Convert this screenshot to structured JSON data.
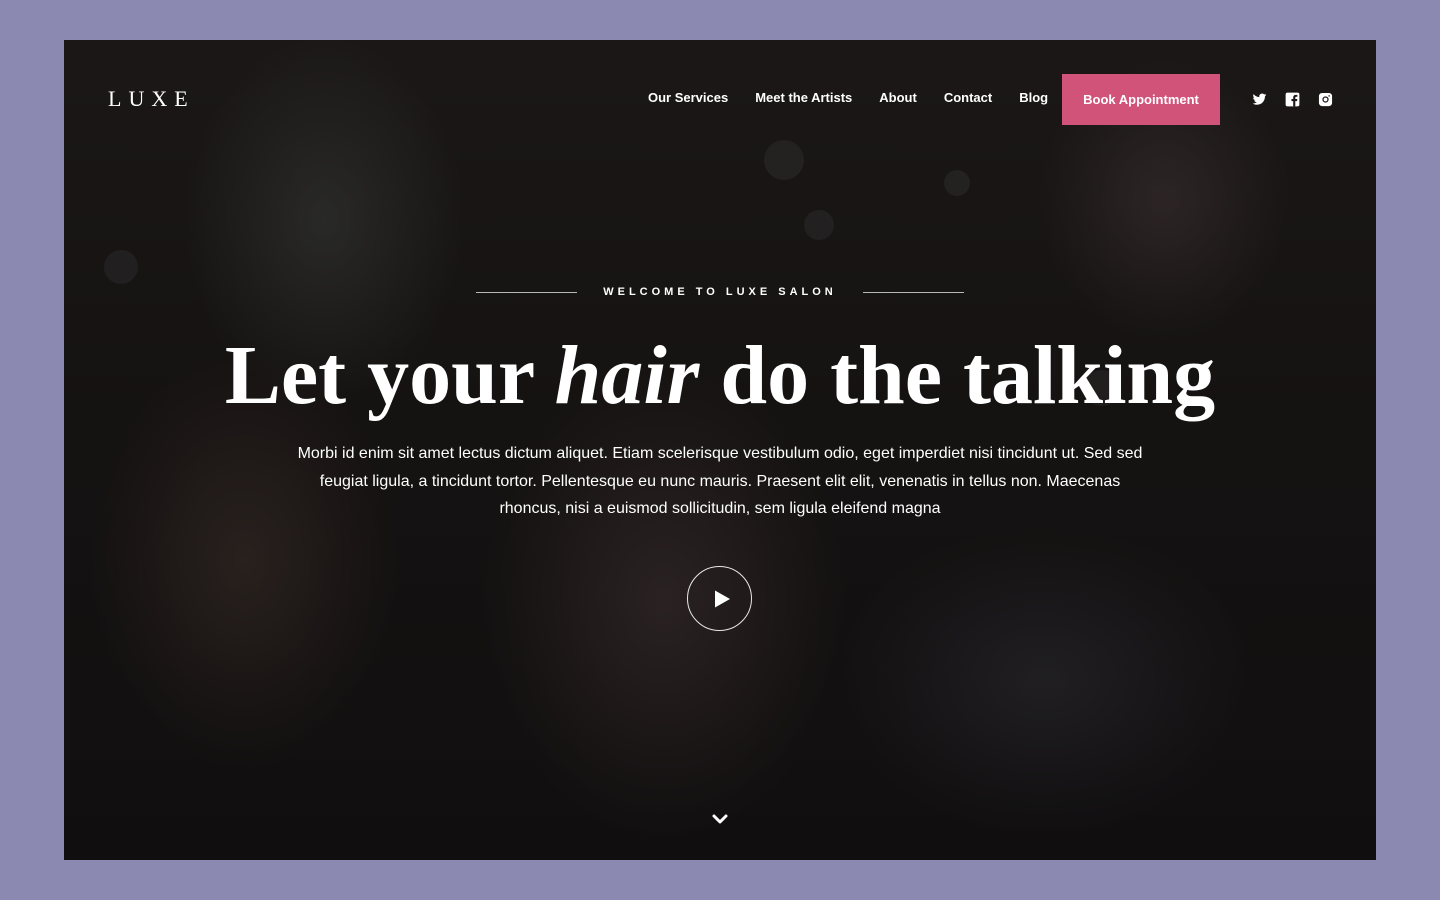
{
  "brand": {
    "logo": "LUXE"
  },
  "nav": {
    "items": [
      {
        "label": "Our Services"
      },
      {
        "label": "Meet the Artists"
      },
      {
        "label": "About"
      },
      {
        "label": "Contact"
      },
      {
        "label": "Blog"
      }
    ],
    "cta_label": "Book Appointment"
  },
  "social": {
    "icons": [
      "twitter-icon",
      "facebook-icon",
      "instagram-icon"
    ]
  },
  "hero": {
    "eyebrow": "WELCOME TO LUXE SALON",
    "title_before": "Let your ",
    "title_emphasis": "hair",
    "title_after": " do the talking",
    "body": "Morbi id enim sit amet lectus dictum aliquet. Etiam scelerisque vestibulum odio, eget imperdiet nisi tincidunt ut. Sed sed feugiat ligula, a tincidunt tortor. Pellentesque eu nunc mauris. Praesent elit elit, venenatis in tellus non. Maecenas rhoncus, nisi a euismod sollicitudin, sem ligula eleifend magna",
    "play_icon": "play-icon",
    "scroll_icon": "chevron-down-icon"
  },
  "colors": {
    "page_background": "#8b88b1",
    "accent": "#d1537a",
    "text": "#ffffff"
  }
}
